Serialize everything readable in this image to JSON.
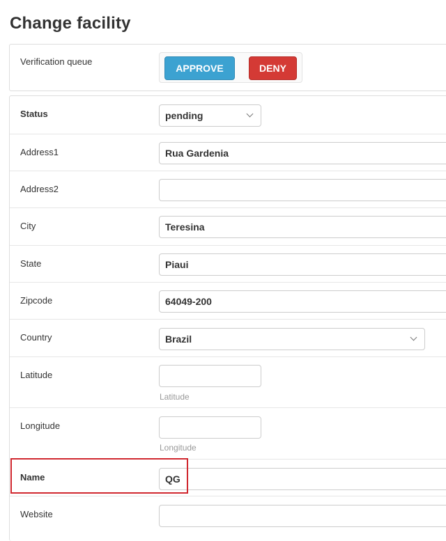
{
  "page": {
    "title": "Change facility"
  },
  "verification_queue": {
    "label": "Verification queue",
    "approve_label": "APPROVE",
    "deny_label": "DENY"
  },
  "fields": {
    "status": {
      "label": "Status",
      "value": "pending"
    },
    "address1": {
      "label": "Address1",
      "value": "Rua Gardenia"
    },
    "address2": {
      "label": "Address2",
      "value": ""
    },
    "city": {
      "label": "City",
      "value": "Teresina"
    },
    "state": {
      "label": "State",
      "value": "Piaui"
    },
    "zipcode": {
      "label": "Zipcode",
      "value": "64049-200"
    },
    "country": {
      "label": "Country",
      "value": "Brazil"
    },
    "latitude": {
      "label": "Latitude",
      "value": "",
      "help": "Latitude"
    },
    "longitude": {
      "label": "Longitude",
      "value": "",
      "help": "Longitude"
    },
    "name": {
      "label": "Name",
      "value": "QG"
    },
    "website": {
      "label": "Website",
      "value": ""
    }
  },
  "colors": {
    "approve": "#3ca2d1",
    "deny": "#d43a35",
    "highlight": "#d0272e"
  }
}
